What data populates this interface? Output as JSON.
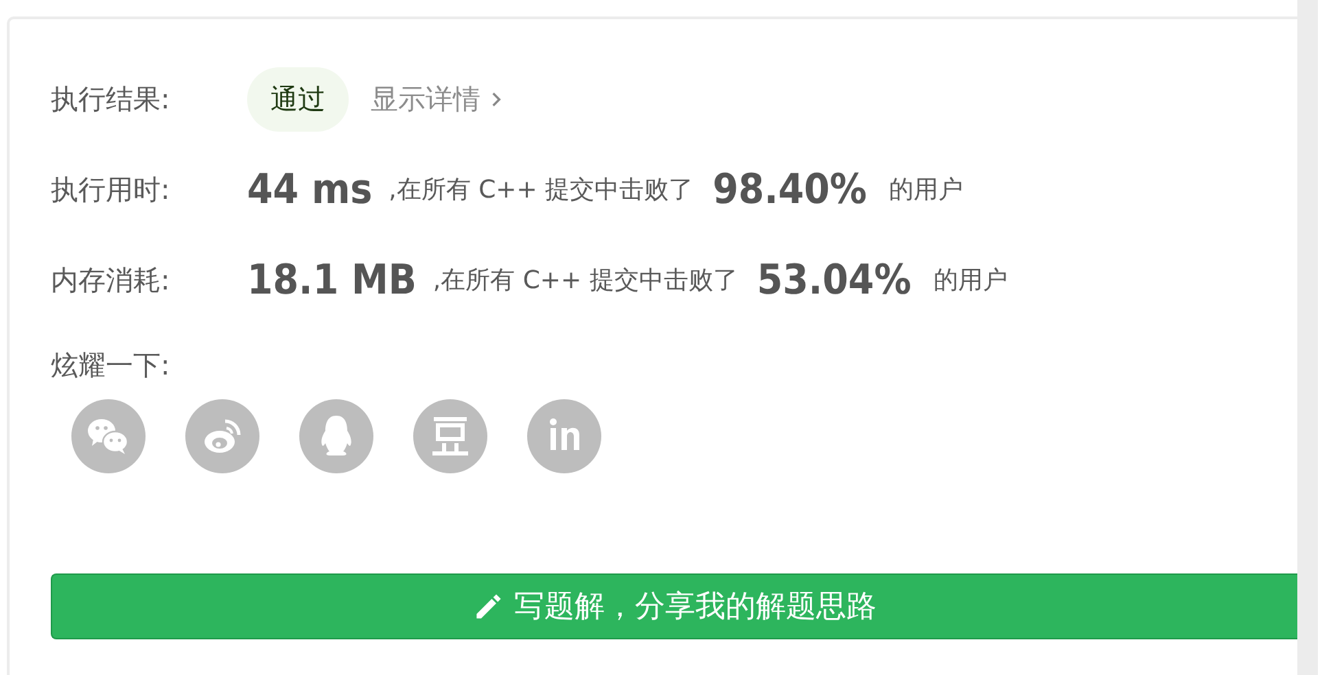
{
  "result": {
    "label": "执行结果:",
    "status": "通过",
    "details_link": "显示详情"
  },
  "stats": [
    {
      "label": "执行用时:",
      "value": "44 ms",
      "text": ",在所有 C++ 提交中击败了",
      "percent": "98.40%",
      "suffix": "的用户"
    },
    {
      "label": "内存消耗:",
      "value": "18.1 MB",
      "text": ",在所有 C++ 提交中击败了",
      "percent": "53.04%",
      "suffix": "的用户"
    }
  ],
  "share": {
    "label": "炫耀一下:",
    "buttons": [
      {
        "kind": "wechat"
      },
      {
        "kind": "weibo"
      },
      {
        "kind": "qq"
      },
      {
        "kind": "douban"
      },
      {
        "kind": "linkedin"
      }
    ]
  },
  "write_button": {
    "label": "写题解，分享我的解题思路"
  }
}
